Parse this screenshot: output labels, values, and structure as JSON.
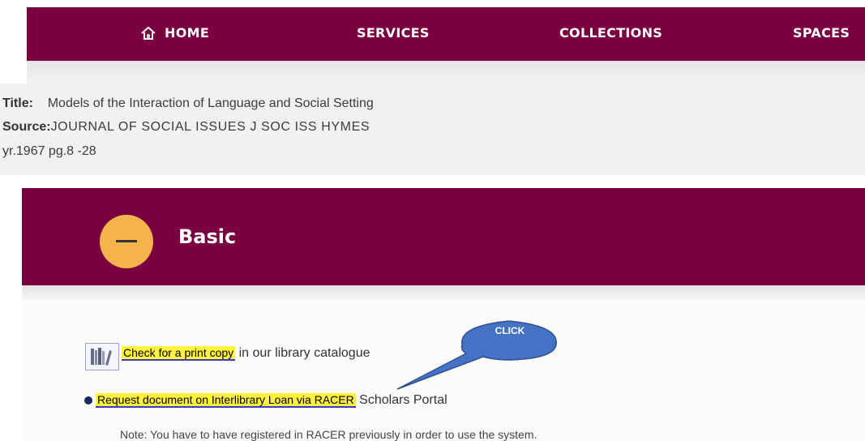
{
  "nav": {
    "home": "HOME",
    "services": "SERVICES",
    "collections": "COLLECTIONS",
    "spaces": "SPACES",
    "bg_color": "#7a0040"
  },
  "record": {
    "title_label": "Title:",
    "title_value": "Models of the Interaction of Language and Social Setting",
    "source_label": "Source:",
    "source_value": "JOURNAL OF SOCIAL ISSUES J SOC ISS HYMES",
    "year_pages": "yr.1967 pg.8 -28"
  },
  "panel": {
    "section_title": "Basic",
    "toggle_icon": "minus-icon",
    "toggle_color": "#f5b34c"
  },
  "options": {
    "print_copy_link": "Check for a print copy",
    "print_copy_suffix": " in our library catalogue",
    "catalogue_icon": "books-icon",
    "racer_link": "Request document on Interlibrary Loan via RACER",
    "racer_suffix": " Scholars Portal",
    "note": "Note: You have to have registered in RACER previously in order to use the system."
  },
  "annotation": {
    "callout_text": "CLICK",
    "callout_color": "#4472c4",
    "highlight_color": "#fff23b"
  }
}
